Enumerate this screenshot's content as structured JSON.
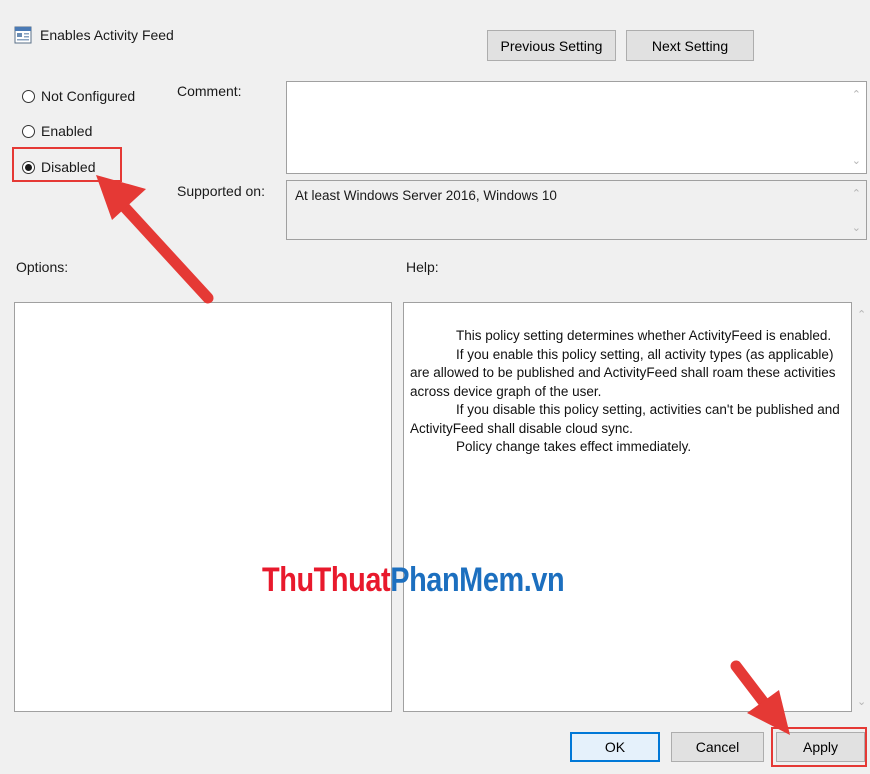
{
  "window": {
    "title": "Enables Activity Feed",
    "icon": "policy-setting-icon"
  },
  "nav": {
    "previous_label": "Previous Setting",
    "next_label": "Next Setting"
  },
  "state": {
    "options": [
      {
        "label": "Not Configured",
        "checked": false
      },
      {
        "label": "Enabled",
        "checked": false
      },
      {
        "label": "Disabled",
        "checked": true
      }
    ]
  },
  "comment": {
    "label": "Comment:",
    "value": ""
  },
  "supported": {
    "label": "Supported on:",
    "value": "At least Windows Server 2016, Windows 10"
  },
  "options_label": "Options:",
  "help": {
    "label": "Help:",
    "paragraphs": [
      "This policy setting determines whether ActivityFeed is enabled.",
      "If you enable this policy setting, all activity types (as applicable) are allowed to be published and ActivityFeed shall roam these activities across device graph of the user.",
      "If you disable this policy setting, activities can't be published and ActivityFeed shall disable cloud sync.",
      "Policy change takes effect immediately."
    ]
  },
  "watermark": {
    "part1": "ThuThuat",
    "part2": "PhanMem",
    "part3": ".vn"
  },
  "footer": {
    "ok_label": "OK",
    "cancel_label": "Cancel",
    "apply_label": "Apply"
  },
  "colors": {
    "annotation": "#e53935",
    "watermark_red": "#e8192c",
    "watermark_blue": "#1c6fbf",
    "default_button": "#0078d7"
  }
}
